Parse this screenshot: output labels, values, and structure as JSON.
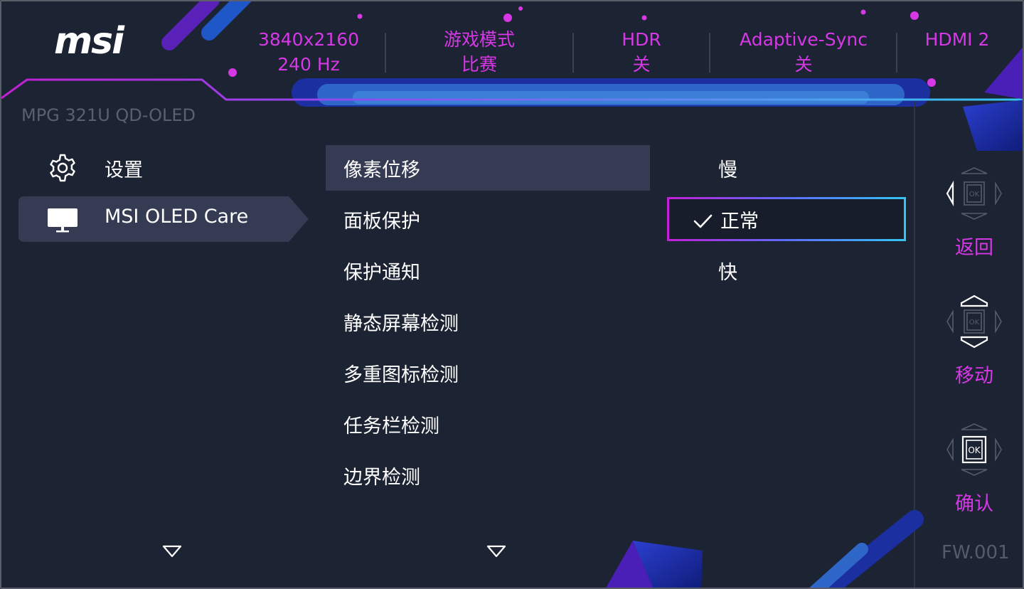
{
  "header": {
    "logo": "msi",
    "status": [
      {
        "line1": "3840x2160",
        "line2": "240 Hz"
      },
      {
        "line1": "游戏模式",
        "line2": "比赛"
      },
      {
        "line1": "HDR",
        "line2": "关"
      },
      {
        "line1": "Adaptive-Sync",
        "line2": "关"
      },
      {
        "line1": "HDMI 2",
        "line2": ""
      }
    ]
  },
  "model": "MPG 321U QD-OLED",
  "sidebar": {
    "items": [
      {
        "label": "设置",
        "icon": "gear-icon"
      },
      {
        "label": "MSI OLED Care",
        "icon": "monitor-icon"
      }
    ]
  },
  "menu": {
    "items": [
      {
        "label": "像素位移"
      },
      {
        "label": "面板保护"
      },
      {
        "label": "保护通知"
      },
      {
        "label": "静态屏幕检测"
      },
      {
        "label": "多重图标检测"
      },
      {
        "label": "任务栏检测"
      },
      {
        "label": "边界检测"
      }
    ]
  },
  "options": {
    "items": [
      {
        "label": "慢"
      },
      {
        "label": "正常"
      },
      {
        "label": "快"
      }
    ]
  },
  "guide": {
    "back": "返回",
    "move": "移动",
    "confirm": "确认",
    "ok_text": "OK"
  },
  "firmware": "FW.001",
  "colors": {
    "accent": "#d638e6",
    "background": "#1c2333",
    "selected_row": "#343b52",
    "highlight_cyan": "#33c5f0"
  }
}
